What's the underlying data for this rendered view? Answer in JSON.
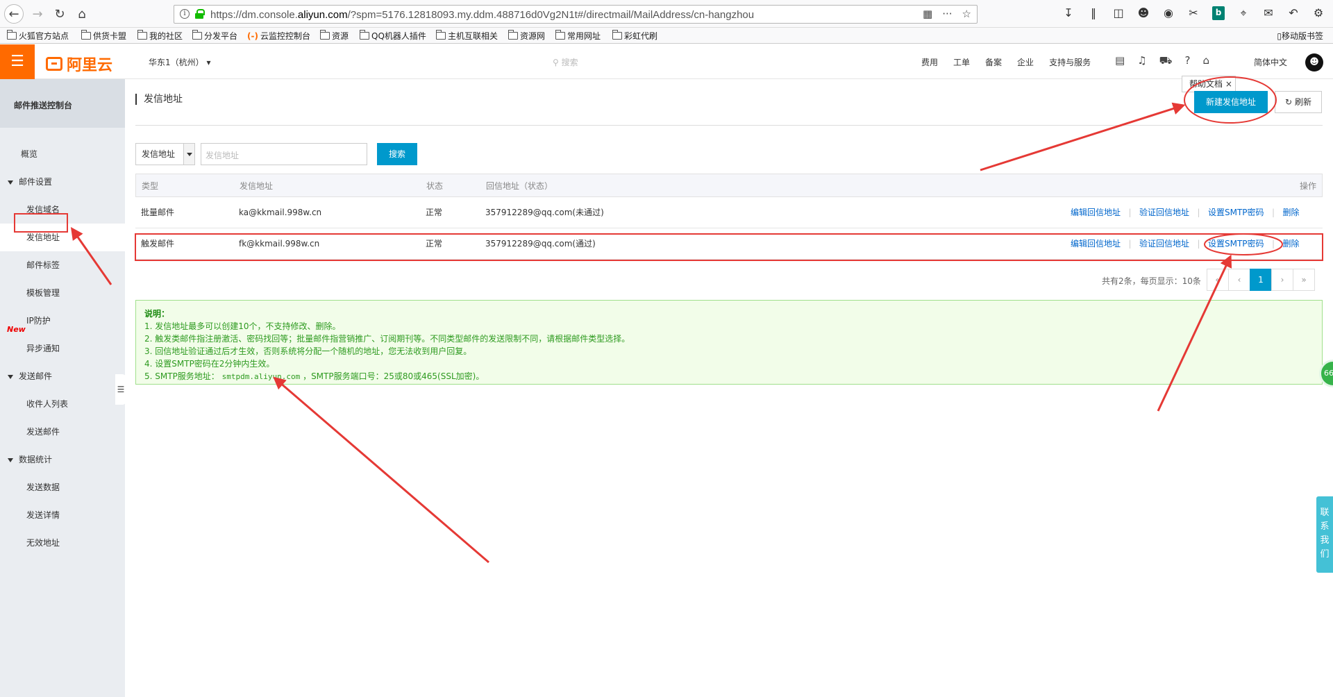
{
  "browser": {
    "url_pre": "https://dm.console.",
    "url_host": "aliyun.com",
    "url_post": "/?spm=5176.12818093.my.ddm.488716d0Vg2N1t#/directmail/MailAddress/cn-hangzhou",
    "bookmarks": [
      "火狐官方站点",
      "供货卡盟",
      "我的社区",
      "分发平台",
      "云监控控制台",
      "资源",
      "QQ机器人插件",
      "主机互联相关",
      "资源网",
      "常用网址",
      "彩虹代刷"
    ],
    "mobile_bookmarks": "移动版书签"
  },
  "topbar": {
    "logo_text": "阿里云",
    "region": "华东1（杭州）",
    "search_placeholder": "搜索",
    "nav": [
      "费用",
      "工单",
      "备案",
      "企业",
      "支持与服务"
    ],
    "language": "简体中文"
  },
  "sidebar": {
    "title": "邮件推送控制台",
    "overview": "概览",
    "group_mail_settings": "邮件设置",
    "items_mail_settings": [
      "发信域名",
      "发信地址",
      "邮件标签",
      "模板管理",
      "IP防护",
      "异步通知"
    ],
    "group_send": "发送邮件",
    "items_send": [
      "收件人列表",
      "发送邮件"
    ],
    "group_stats": "数据统计",
    "items_stats": [
      "发送数据",
      "发送详情",
      "无效地址"
    ],
    "new_badge": "New"
  },
  "main": {
    "page_title": "发信地址",
    "help_tip": "帮助文档",
    "new_button": "新建发信地址",
    "refresh_button": "刷新",
    "filter_select": "发信地址",
    "filter_placeholder": "发信地址",
    "search_button": "搜索",
    "table": {
      "headers": [
        "类型",
        "发信地址",
        "状态",
        "回信地址（状态）",
        "操作"
      ],
      "rows": [
        {
          "type": "批量邮件",
          "address": "ka@kkmail.998w.cn",
          "status": "正常",
          "reply": "357912289@qq.com(未通过)"
        },
        {
          "type": "触发邮件",
          "address": "fk@kkmail.998w.cn",
          "status": "正常",
          "reply": "357912289@qq.com(通过)"
        }
      ],
      "actions": [
        "编辑回信地址",
        "验证回信地址",
        "设置SMTP密码",
        "删除"
      ]
    },
    "pager": {
      "summary": "共有2条，每页显示：10条",
      "buttons": [
        "«",
        "‹",
        "1",
        "›",
        "»"
      ]
    },
    "notes": {
      "title": "说明：",
      "lines": [
        "1. 发信地址最多可以创建10个，不支持修改、删除。",
        "2. 触发类邮件指注册激活、密码找回等；批量邮件指营销推广、订阅期刊等。不同类型邮件的发送限制不同，请根据邮件类型选择。",
        "3. 回信地址验证通过后才生效，否则系统将分配一个随机的地址，您无法收到用户回复。",
        "4. 设置SMTP密码在2分钟内生效。"
      ],
      "line5_prefix": "5. SMTP服务地址：",
      "smtp_host": "smtpdm.aliyun.com",
      "line5_suffix": "，SMTP服务端口号：25或80或465(SSL加密)。"
    }
  },
  "floating": {
    "contact": [
      "联",
      "系",
      "我",
      "们"
    ],
    "badge": "66"
  },
  "colors": {
    "brand": "#ff6a00",
    "primary": "#0099cc",
    "annotation": "#e53935",
    "notes_bg": "#f2fde9"
  }
}
